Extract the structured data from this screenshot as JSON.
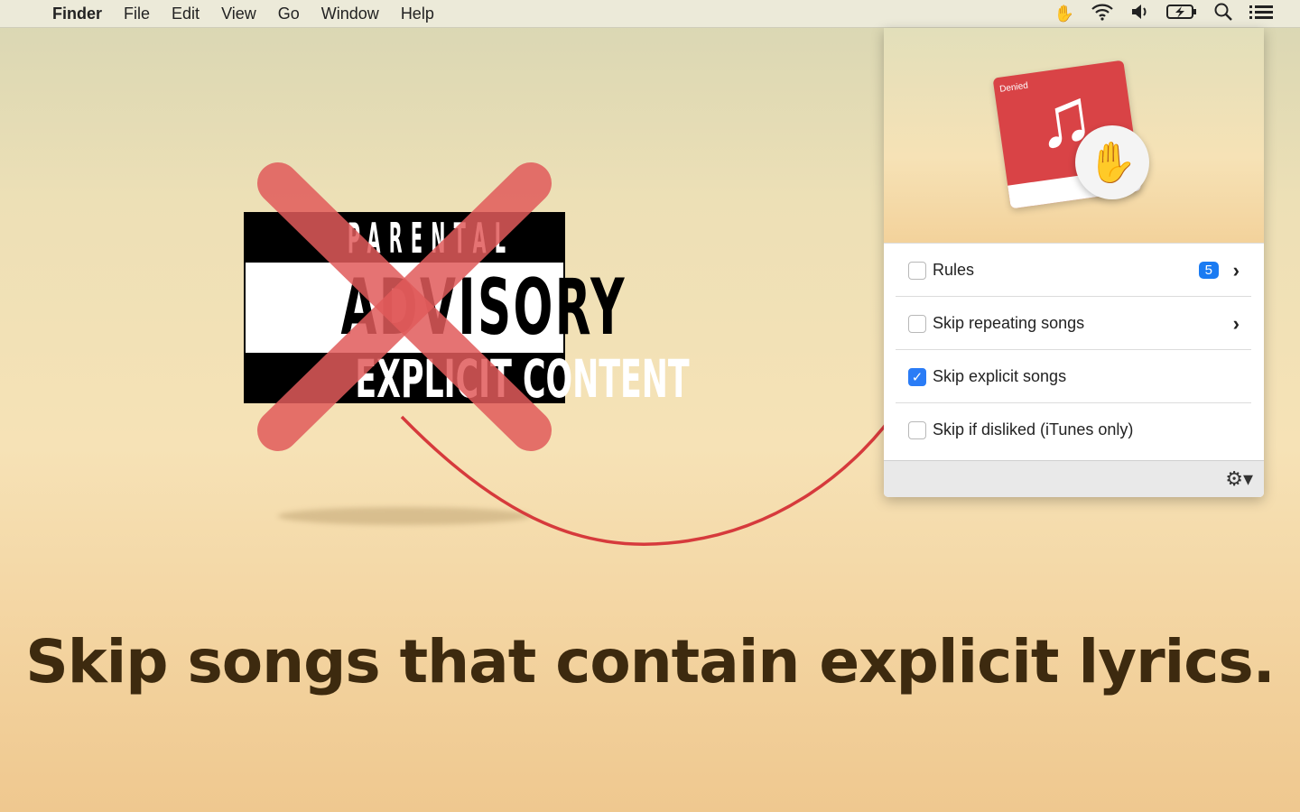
{
  "menubar": {
    "apple": "",
    "app": "Finder",
    "items": [
      "File",
      "Edit",
      "View",
      "Go",
      "Window",
      "Help"
    ]
  },
  "status_icons": [
    "hand-icon",
    "wifi-icon",
    "volume-icon",
    "battery-charging-icon",
    "search-icon",
    "list-icon"
  ],
  "advisory": {
    "line1": "PARENTAL",
    "line2": "ADVISORY",
    "line3": "EXPLICIT CONTENT"
  },
  "app_icon_label": "Denied",
  "popover": {
    "rows": [
      {
        "label": "Rules",
        "checked": false,
        "badge": "5",
        "chevron": true
      },
      {
        "label": "Skip repeating songs",
        "checked": false,
        "chevron": true
      },
      {
        "label": "Skip explicit songs",
        "checked": true
      },
      {
        "label": "Skip if disliked (iTunes only)",
        "checked": false
      }
    ]
  },
  "tagline": "Skip songs that contain explicit lyrics.",
  "colors": {
    "accent": "#2a7cf6",
    "red": "#d94346",
    "text": "#3d2a0f"
  }
}
